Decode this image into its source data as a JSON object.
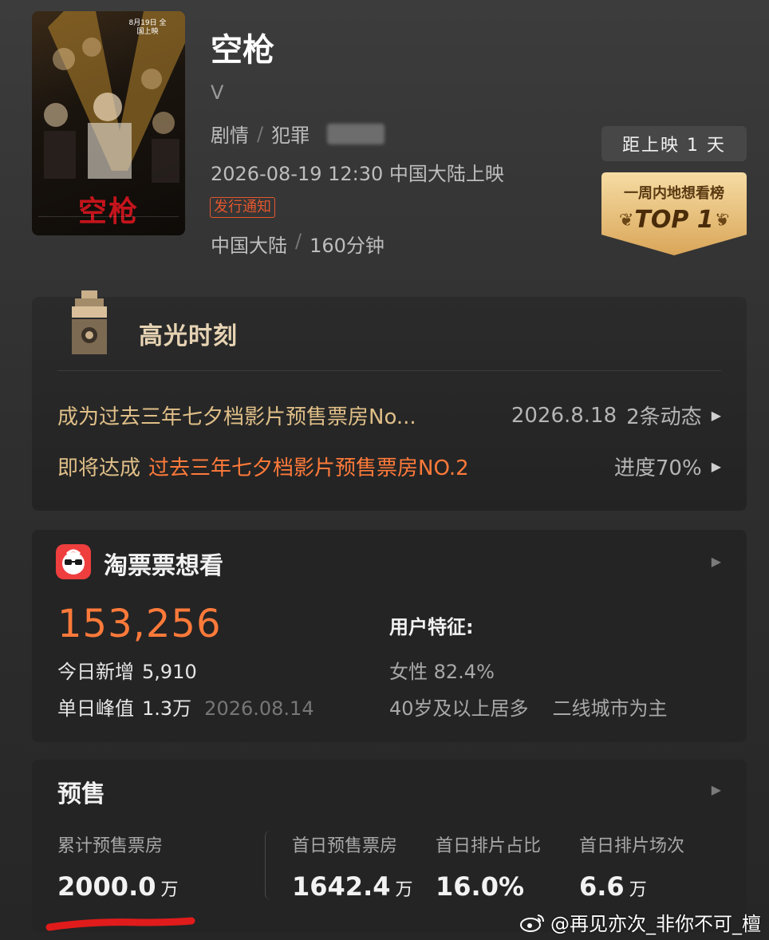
{
  "movie": {
    "title": "空枪",
    "subtitle": "V",
    "genres": [
      "剧情",
      "犯罪"
    ],
    "release": "2026-08-19 12:30 中国大陆上映",
    "notice_badge": "发行通知",
    "country": "中国大陆",
    "duration": "160分钟",
    "poster": {
      "title_text": "空枪",
      "date_text": "8月19日 全国上映"
    }
  },
  "countdown": "距上映 1 天",
  "rank_badge": {
    "title": "一周内地想看榜",
    "value": "TOP 1"
  },
  "highlights": {
    "title": "高光时刻",
    "items": [
      {
        "text": "成为过去三年七夕档影片预售票房No...",
        "date": "2026.8.18",
        "meta": "2条动态"
      },
      {
        "prefix": "即将达成",
        "target": "过去三年七夕档影片预售票房NO.2",
        "progress_label": "进度70%"
      }
    ]
  },
  "wish": {
    "app_name": "淘票票想看",
    "count": "153,256",
    "today_label": "今日新增",
    "today_value": "5,910",
    "peak_label": "单日峰值",
    "peak_value": "1.3万",
    "peak_date": "2026.08.14",
    "features_title": "用户特征:",
    "female": "女性 82.4%",
    "age": "40岁及以上居多",
    "city": "二线城市为主"
  },
  "presale": {
    "title": "预售",
    "stats": [
      {
        "label": "累计预售票房",
        "value": "2000.0",
        "unit": "万"
      },
      {
        "label": "首日预售票房",
        "value": "1642.4",
        "unit": "万"
      },
      {
        "label": "首日排片占比",
        "value": "16.0%",
        "unit": ""
      },
      {
        "label": "首日排片场次",
        "value": "6.6",
        "unit": "万"
      }
    ]
  },
  "watermark": "@再见亦次_非你不可_檀",
  "colors": {
    "accent_orange": "#ff7a3a",
    "highlight_gold": "#e0bf88",
    "badge_gold": "#e8c27a",
    "underline_red": "#e01b1b"
  },
  "icons": {
    "more": "play-triangle-icon",
    "highlight": "camera-tower-icon",
    "app": "taopiaopiao-icon",
    "weibo": "weibo-icon"
  }
}
